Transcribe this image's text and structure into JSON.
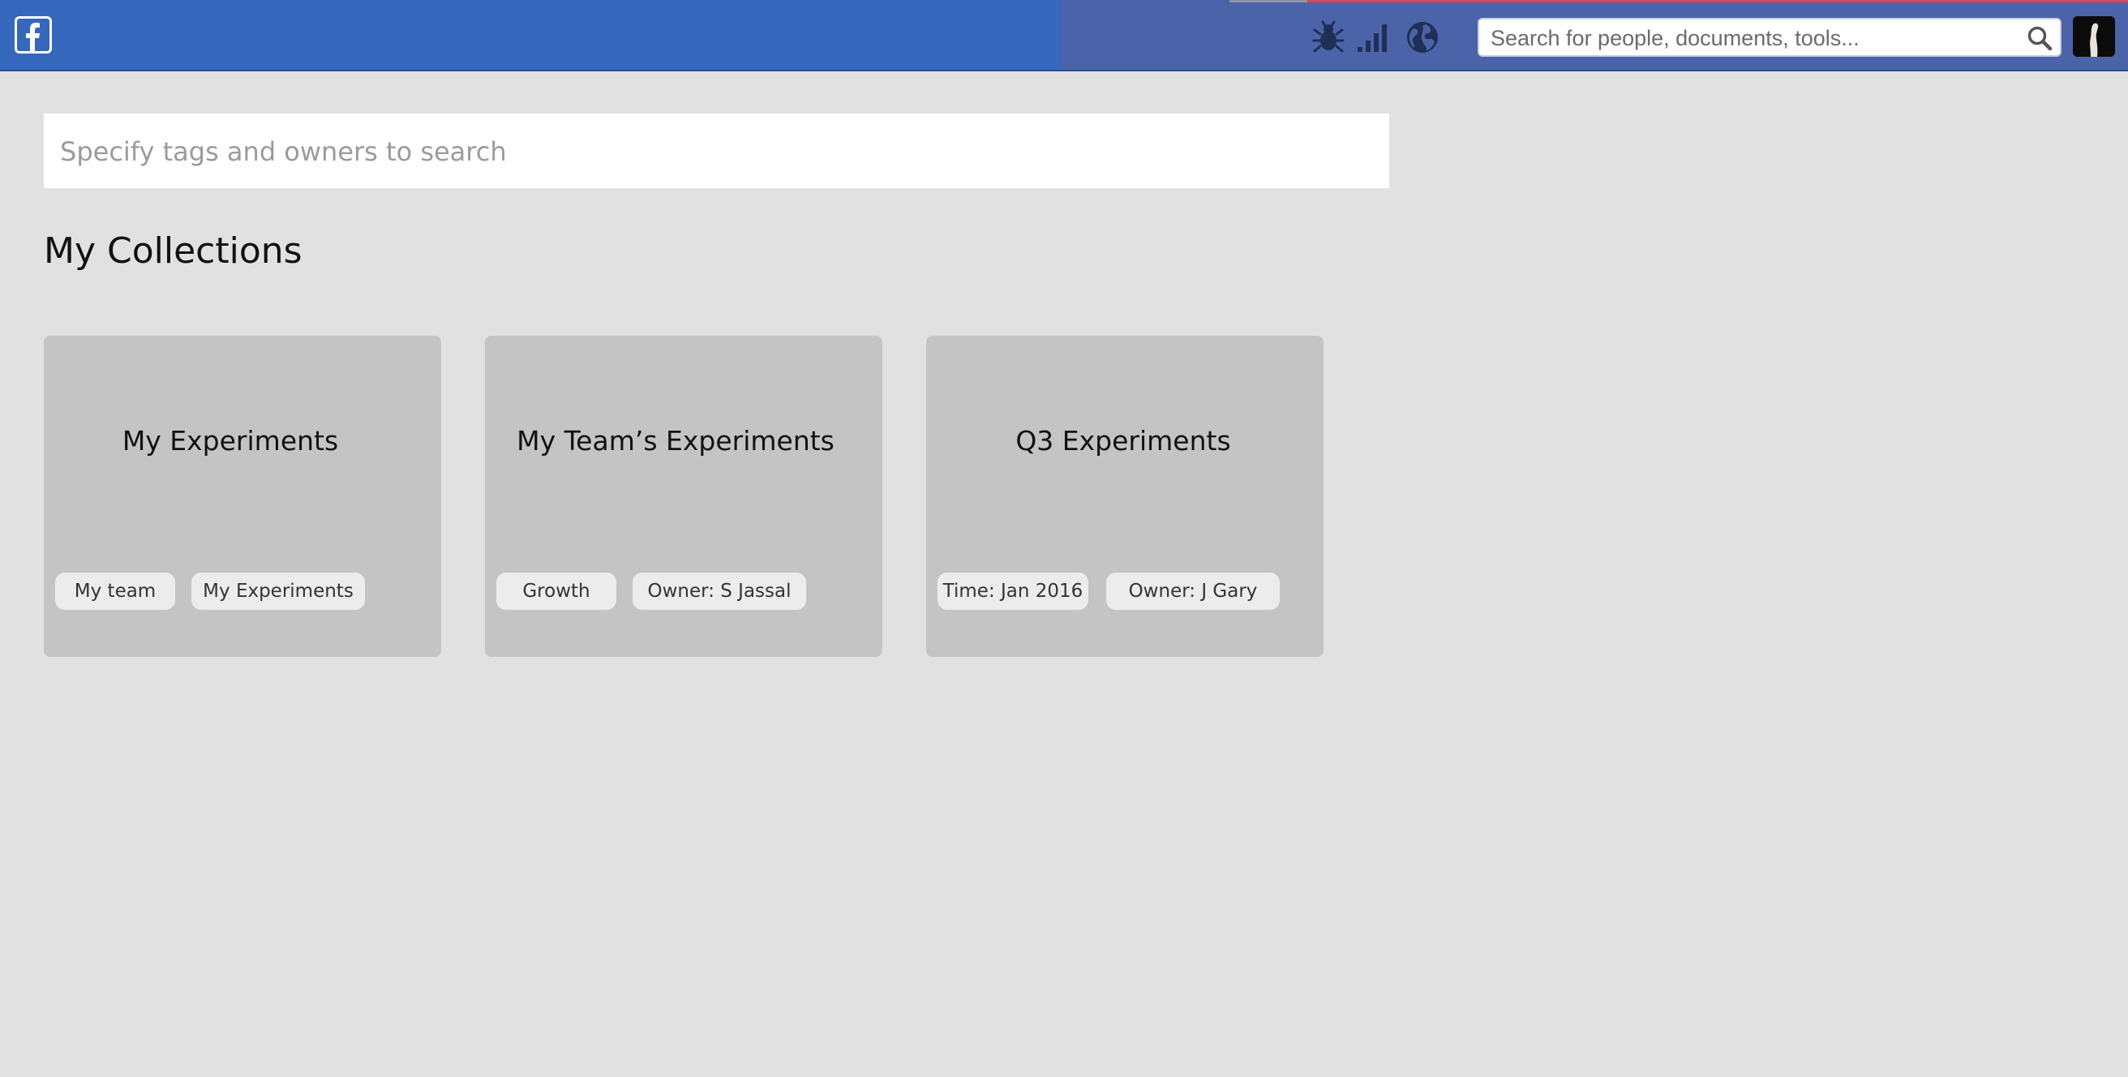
{
  "header": {
    "logo_icon": "facebook-logo-icon",
    "icons": [
      "bug-icon",
      "signal-bars-icon",
      "globe-icon"
    ],
    "search": {
      "placeholder": "Search for people, documents, tools...",
      "value": "",
      "icon": "magnifier-icon"
    },
    "avatar_icon": "profile-avatar"
  },
  "tag_search": {
    "placeholder": "Specify tags and owners to search",
    "value": ""
  },
  "collections": {
    "title": "My Collections",
    "cards": [
      {
        "title": "My Experiments",
        "tags": [
          "My team",
          "My Experiments"
        ]
      },
      {
        "title": "My Team’s Experiments",
        "tags": [
          "Growth",
          "Owner: S Jassal"
        ]
      },
      {
        "title": "Q3 Experiments",
        "tags": [
          "Time: Jan 2016",
          "Owner: J Gary"
        ]
      }
    ]
  },
  "colors": {
    "topbar": "#3567bd",
    "page_background": "#e1e1e1",
    "card_background": "#c4c4c4",
    "tag_background": "#ececec"
  }
}
